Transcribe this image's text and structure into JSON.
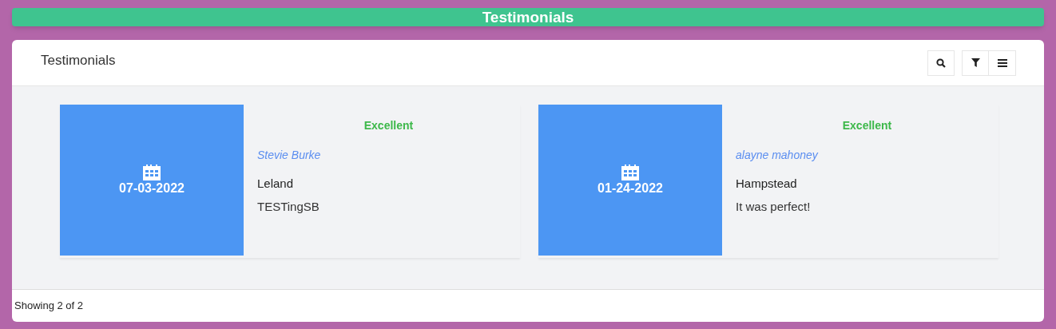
{
  "banner": {
    "title": "Testimonials"
  },
  "panel": {
    "title": "Testimonials"
  },
  "toolbar": [
    {
      "kind": "search"
    },
    {
      "kind": "filter"
    },
    {
      "kind": "menu"
    }
  ],
  "testimonials": [
    {
      "date": "07-03-2022",
      "rating": "Excellent",
      "name": "Stevie Burke",
      "location": "Leland",
      "comment": "TESTingSB"
    },
    {
      "date": "01-24-2022",
      "rating": "Excellent",
      "name": "alayne mahoney",
      "location": "Hampstead",
      "comment": "It was perfect!"
    }
  ],
  "footer": {
    "text": "Showing 2 of 2"
  }
}
